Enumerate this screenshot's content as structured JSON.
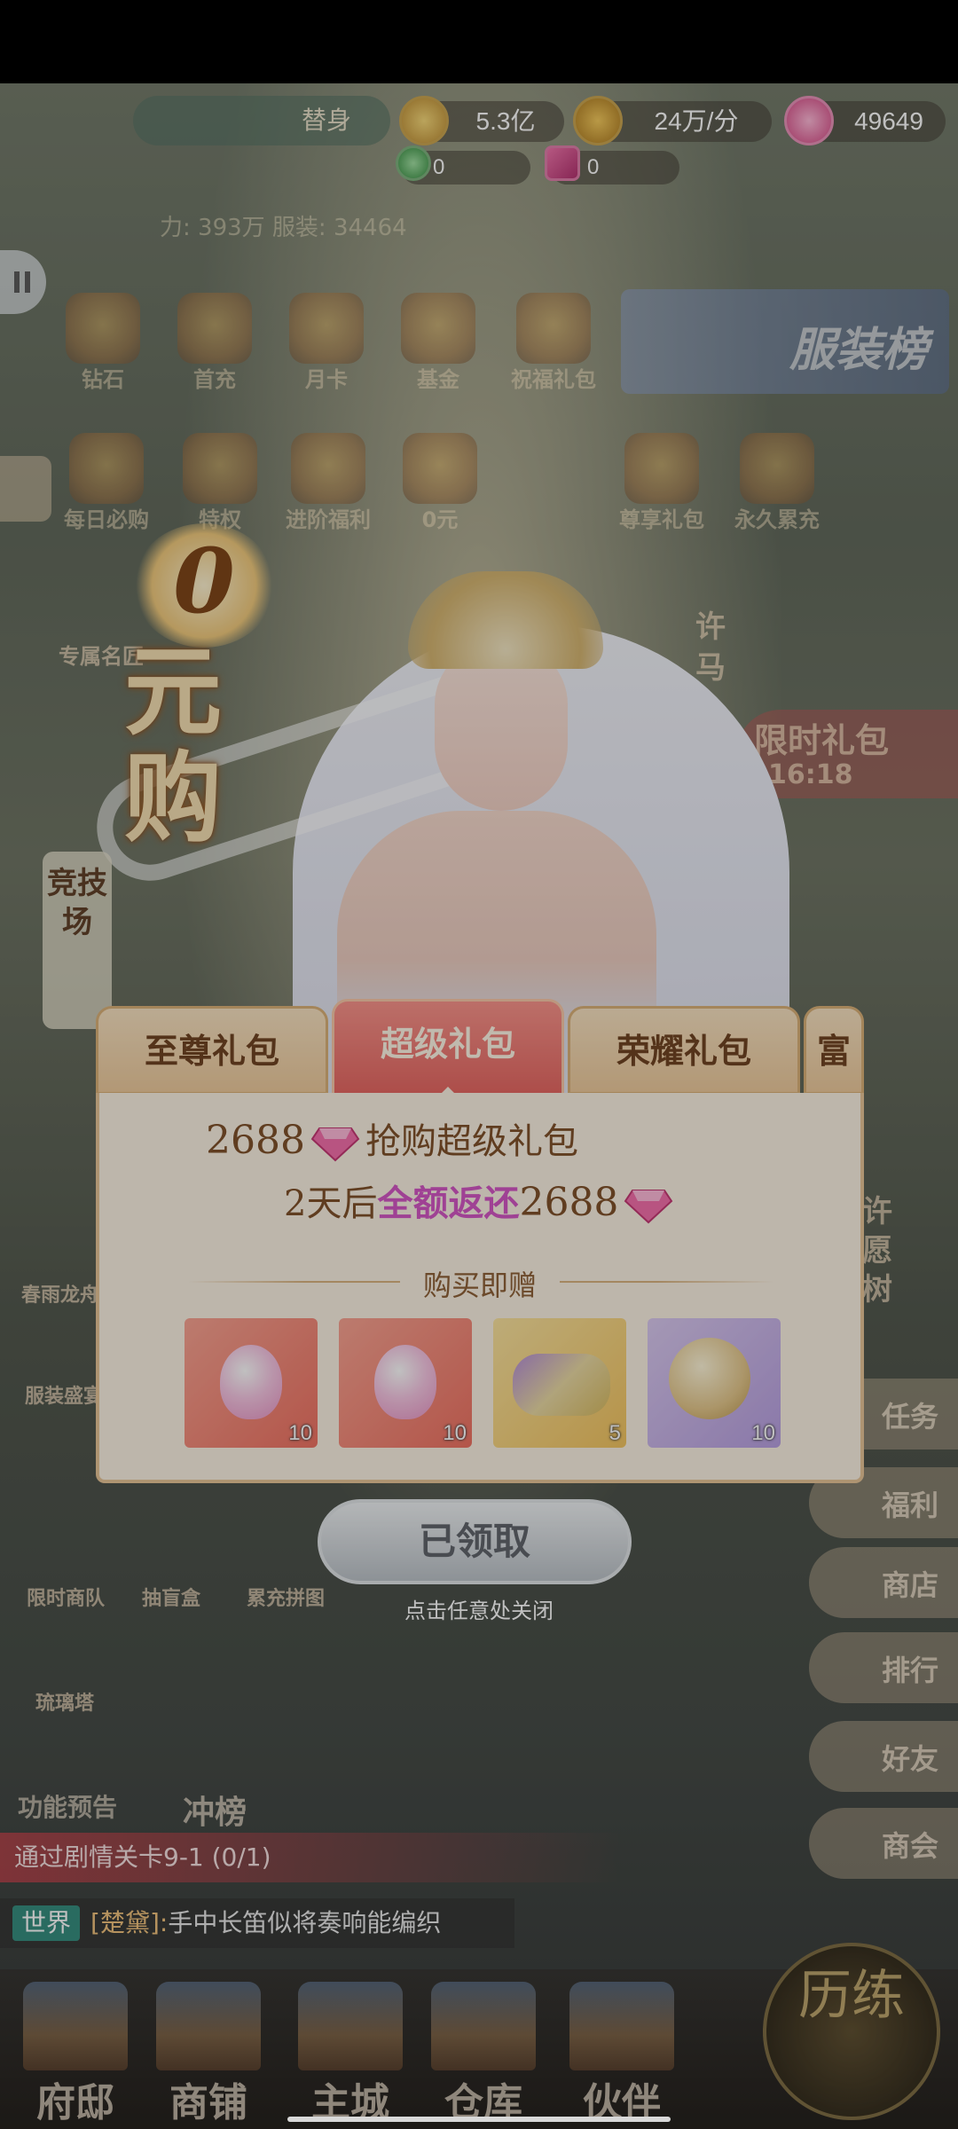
{
  "top": {
    "name_partial": "替身",
    "coins": "5.3亿",
    "income": "24万/分",
    "gems": "49649",
    "green_val": "0",
    "ticket_val": "0",
    "power_line": "力: 393万 服装: 34464"
  },
  "menu_row1": [
    "钻石",
    "首充",
    "月卡",
    "基金",
    "祝福礼包"
  ],
  "menu_row2": [
    "每日必购",
    "特权",
    "进阶福利",
    "0元",
    "尊享礼包",
    "永久累充"
  ],
  "fashion_banner": "服装榜",
  "promo": {
    "zero": "0",
    "yuan_gou": "元购"
  },
  "arena": "竞技场",
  "side_texts": {
    "tongren": "专属名匠",
    "xuma": "许马",
    "timer_label": "限时礼包",
    "timer_value": "16:18",
    "wish_tree": "许愿树"
  },
  "dialog": {
    "tabs": [
      "至尊礼包",
      "超级礼包",
      "荣耀礼包",
      "富"
    ],
    "active_tab": 1,
    "line1_amount": "2688",
    "line1_text": "抢购超级礼包",
    "line2_prefix": "2天后",
    "line2_highlight": "全额返还",
    "line2_amount": "2688",
    "gift_title": "购买即赠",
    "items": [
      {
        "name": "pink-crystal-egg",
        "count": "10",
        "bg": "#f48a78"
      },
      {
        "name": "pink-crystal-egg",
        "count": "10",
        "bg": "#f48a78"
      },
      {
        "name": "silk-rolls",
        "count": "5",
        "bg": "#f6d27a"
      },
      {
        "name": "thread-spool",
        "count": "10",
        "bg": "#c7b3e8"
      }
    ],
    "claim_label": "已领取",
    "close_hint": "点击任意处关闭"
  },
  "right_menu": [
    "任务",
    "福利",
    "商店",
    "排行",
    "好友",
    "商会"
  ],
  "left_menu": [
    "春雨龙舟",
    "服装盛宴",
    "限时商队",
    "抽盲盒",
    "累充拼图",
    "琉璃塔"
  ],
  "func_preview": "功能预告",
  "rank_btn": "冲榜",
  "quest": "通过剧情关卡9-1 (0/1)",
  "chat": {
    "channel": "世界",
    "speaker": "[楚黛]:",
    "message": "手中长笛似将奏响能编织"
  },
  "bottom_nav": [
    "府邸",
    "商铺",
    "主城",
    "仓库",
    "伙伴"
  ],
  "lilian": "历练",
  "colors": {
    "active_tab": "#e45f5a",
    "panel": "#fbf1e2",
    "highlight": "#d24fc2",
    "text_brown": "#7a4a22"
  }
}
